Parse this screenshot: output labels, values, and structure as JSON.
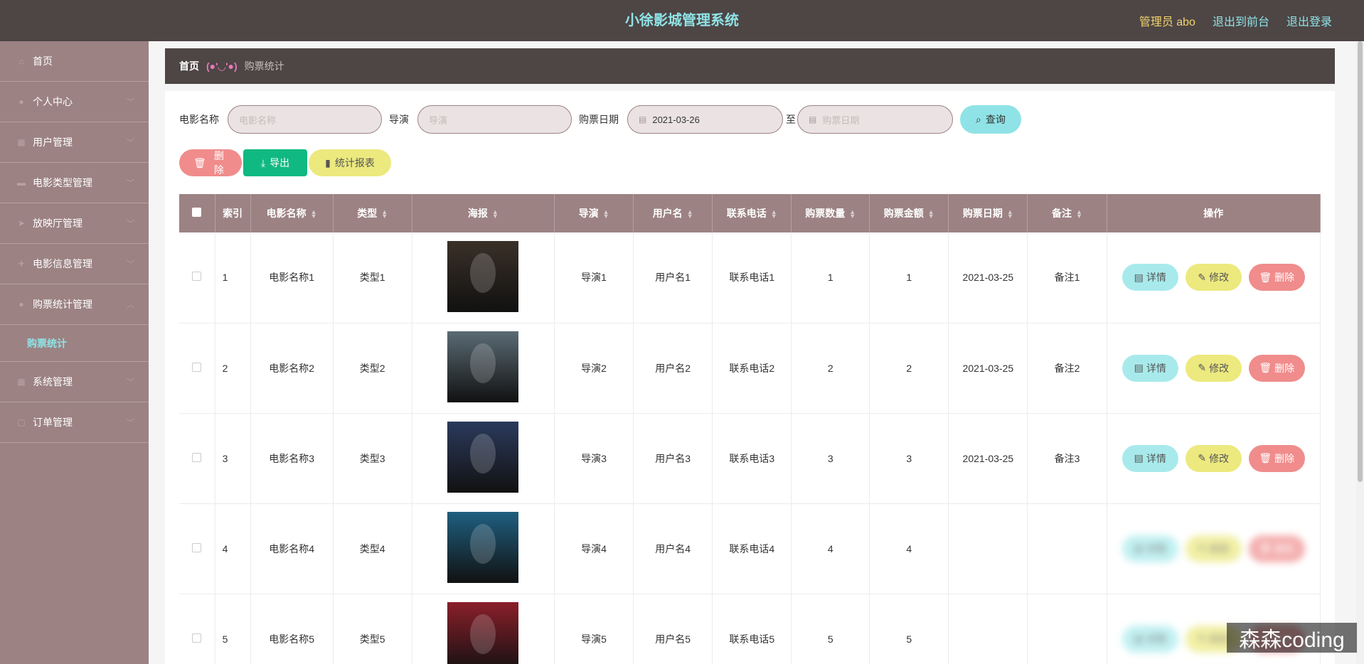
{
  "header": {
    "title": "小徐影城管理系统",
    "admin_label": "管理员 abo",
    "front_link": "退出到前台",
    "logout_link": "退出登录"
  },
  "sidebar": {
    "items": [
      {
        "label": "首页",
        "icon": "home-icon"
      },
      {
        "label": "个人中心",
        "icon": "user-icon"
      },
      {
        "label": "用户管理",
        "icon": "grid-icon"
      },
      {
        "label": "电影类型管理",
        "icon": "folder-icon"
      },
      {
        "label": "放映厅管理",
        "icon": "send-icon"
      },
      {
        "label": "电影信息管理",
        "icon": "plane-icon"
      },
      {
        "label": "购票统计管理",
        "icon": "user-icon"
      }
    ],
    "sub_active": "购票统计",
    "items_after": [
      {
        "label": "系统管理",
        "icon": "grid-icon"
      },
      {
        "label": "订单管理",
        "icon": "doc-icon"
      }
    ]
  },
  "breadcrumb": {
    "home": "首页",
    "separator": "(●'◡'●)",
    "current": "购票统计"
  },
  "search": {
    "movie_label": "电影名称",
    "movie_placeholder": "电影名称",
    "director_label": "导演",
    "director_placeholder": "导演",
    "date_label": "购票日期",
    "date_start": "2021-03-26",
    "date_to": "至",
    "date_end_placeholder": "购票日期",
    "query_button": "查询"
  },
  "actions": {
    "delete": "删除",
    "export": "导出",
    "report": "统计报表"
  },
  "table": {
    "columns": [
      "索引",
      "电影名称",
      "类型",
      "海报",
      "导演",
      "用户名",
      "联系电话",
      "购票数量",
      "购票金额",
      "购票日期",
      "备注",
      "操作"
    ],
    "rows": [
      {
        "index": "1",
        "name": "电影名称1",
        "type": "类型1",
        "director": "导演1",
        "user": "用户名1",
        "phone": "联系电话1",
        "qty": "1",
        "amount": "1",
        "date": "2021-03-25",
        "note": "备注1",
        "poster_color": "#3a3028"
      },
      {
        "index": "2",
        "name": "电影名称2",
        "type": "类型2",
        "director": "导演2",
        "user": "用户名2",
        "phone": "联系电话2",
        "qty": "2",
        "amount": "2",
        "date": "2021-03-25",
        "note": "备注2",
        "poster_color": "#5a6b75"
      },
      {
        "index": "3",
        "name": "电影名称3",
        "type": "类型3",
        "director": "导演3",
        "user": "用户名3",
        "phone": "联系电话3",
        "qty": "3",
        "amount": "3",
        "date": "2021-03-25",
        "note": "备注3",
        "poster_color": "#2b3a5c"
      },
      {
        "index": "4",
        "name": "电影名称4",
        "type": "类型4",
        "director": "导演4",
        "user": "用户名4",
        "phone": "联系电话4",
        "qty": "4",
        "amount": "4",
        "date": "",
        "note": "",
        "poster_color": "#1f5f80"
      },
      {
        "index": "5",
        "name": "电影名称5",
        "type": "类型5",
        "director": "导演5",
        "user": "用户名5",
        "phone": "联系电话5",
        "qty": "5",
        "amount": "5",
        "date": "",
        "note": "",
        "poster_color": "#8a1f2a"
      }
    ],
    "row_buttons": {
      "view": "详情",
      "edit": "修改",
      "delete": "删除"
    }
  },
  "watermark": "森森coding",
  "colors": {
    "topbar": "#4e4545",
    "sidebar": "#9c8283",
    "accent_cyan": "#8fe3e6",
    "accent_yellow": "#ece97e",
    "accent_red": "#f08c8c",
    "export_green": "#10b981"
  }
}
